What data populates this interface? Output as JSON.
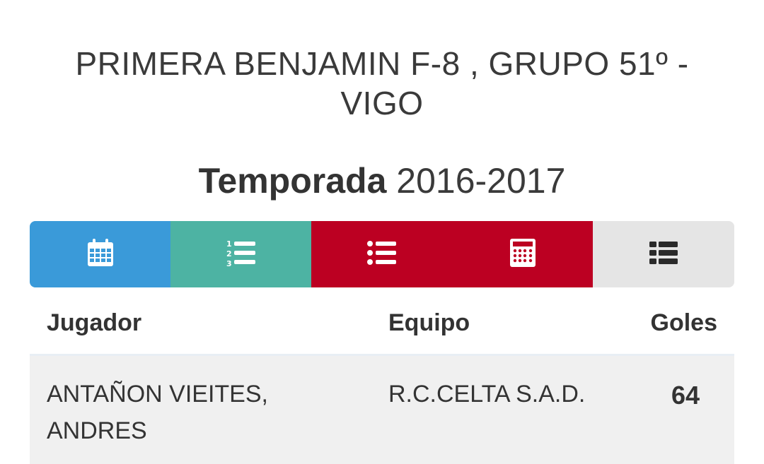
{
  "header": {
    "competition_title": "PRIMERA BENJAMIN F-8 , GRUPO 51º - VIGO",
    "season_label": "Temporada",
    "season_value": "2016-2017"
  },
  "tabs": [
    {
      "icon": "calendar-icon",
      "color": "#3a9ad9"
    },
    {
      "icon": "ordered-list-icon",
      "color": "#4db3a3"
    },
    {
      "icon": "bullet-list-icon",
      "color": "#bc0022"
    },
    {
      "icon": "calculator-icon",
      "color": "#bc0022"
    },
    {
      "icon": "table-list-icon",
      "color": "#e5e5e5"
    }
  ],
  "table": {
    "columns": {
      "player": "Jugador",
      "team": "Equipo",
      "goals": "Goles"
    },
    "rows": [
      {
        "player": "ANTAÑON VIEITES, ANDRES",
        "team": "R.C.CELTA S.A.D.",
        "goals": "64"
      }
    ]
  }
}
